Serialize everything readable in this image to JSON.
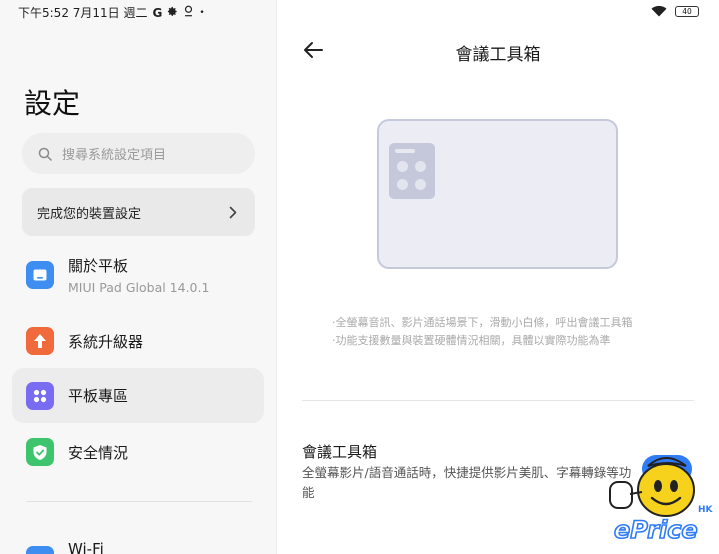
{
  "status_bar": {
    "time": "下午5:52 7月11日 週二",
    "icons": [
      "google-icon",
      "gear-icon",
      "location-icon",
      "dot-icon"
    ],
    "right_icons": [
      "wifi-icon",
      "battery-icon"
    ],
    "battery": "40"
  },
  "settings": {
    "title": "設定",
    "search_placeholder": "搜尋系統設定項目",
    "setup_card_label": "完成您的裝置設定",
    "items": [
      {
        "label": "關於平板",
        "sub": "MIUI Pad Global 14.0.1",
        "icon": "tablet-icon",
        "color": "#3d8ef0"
      },
      {
        "label": "系統升級器",
        "icon": "arrow-up-icon",
        "color": "#f06a3b"
      },
      {
        "label": "平板專區",
        "icon": "grid-dots-icon",
        "color": "#7a6cf2",
        "selected": true
      },
      {
        "label": "安全情況",
        "icon": "shield-check-icon",
        "color": "#3ec46d"
      }
    ],
    "wifi_label": "Wi-Fi"
  },
  "detail": {
    "back_icon": "back-arrow-icon",
    "title": "會議工具箱",
    "desc_line1": "·全螢幕音訊、影片通話場景下，滑動小白條，呼出會議工具箱",
    "desc_line2": "·功能支援數量與裝置硬體情況相關，具體以實際功能為準",
    "feature_title": "會議工具箱",
    "feature_desc": "全螢幕影片/語音通話時，快捷提供影片美肌、字幕轉錄等功能",
    "toggle_on": true
  },
  "watermark": {
    "brand": "ePrice",
    "region": "HK"
  },
  "colors": {
    "accent": "#2f7cf6",
    "illustration_fill": "#ecedf4",
    "illustration_border": "#c6c9dc"
  }
}
